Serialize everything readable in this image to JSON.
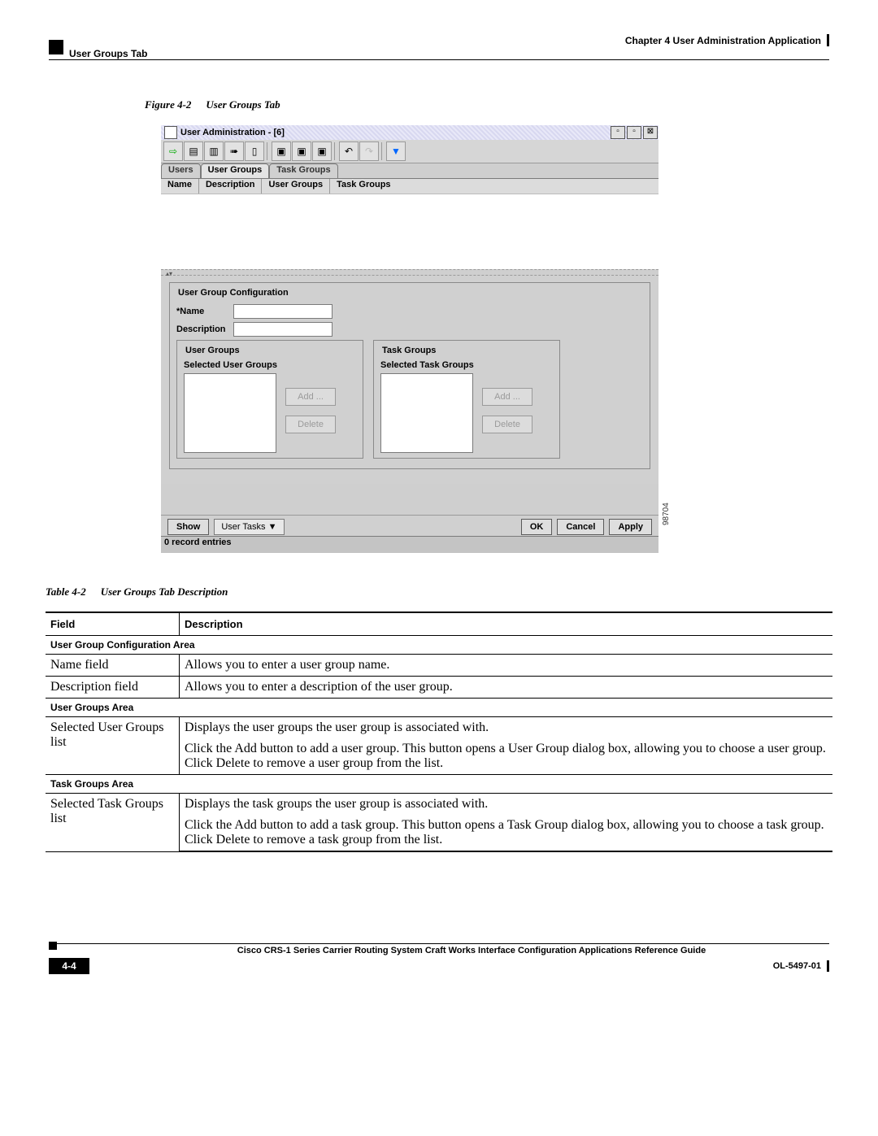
{
  "header": {
    "chapter": "Chapter 4    User Administration Application",
    "section": "User Groups Tab"
  },
  "figure_caption": {
    "num": "Figure 4-2",
    "title": "User Groups Tab"
  },
  "screenshot": {
    "window_title": "User Administration - [6]",
    "image_id": "98704",
    "tabs": [
      "Users",
      "User Groups",
      "Task Groups"
    ],
    "active_tab": "User Groups",
    "columns": [
      "Name",
      "Description",
      "User Groups",
      "Task Groups"
    ],
    "form": {
      "legend": "User Group Configuration",
      "name_label": "*Name",
      "description_label": "Description",
      "user_groups": {
        "legend": "User Groups",
        "sublabel": "Selected User Groups",
        "add": "Add ...",
        "delete": "Delete"
      },
      "task_groups": {
        "legend": "Task Groups",
        "sublabel": "Selected Task Groups",
        "add": "Add ...",
        "delete": "Delete"
      }
    },
    "footer": {
      "show": "Show",
      "selector": "User Tasks ▼",
      "ok": "OK",
      "cancel": "Cancel",
      "apply": "Apply"
    },
    "status": "0 record entries"
  },
  "table_caption": {
    "num": "Table 4-2",
    "title": "User Groups Tab Description"
  },
  "table": {
    "headers": {
      "field": "Field",
      "desc": "Description"
    },
    "section1": "User Group Configuration Area",
    "row1": {
      "f": "Name field",
      "d": "Allows you to enter a user group name."
    },
    "row2": {
      "f": "Description field",
      "d": "Allows you to enter a description of the user group."
    },
    "section2": "User Groups Area",
    "row3": {
      "f": "Selected User Groups list",
      "d1": "Displays the user groups the user group is associated with.",
      "d2": "Click the Add button to add a user group. This button opens a User Group dialog box, allowing you to choose a user group. Click Delete to remove a user group from the list."
    },
    "section3": "Task Groups Area",
    "row4": {
      "f": "Selected Task Groups list",
      "d1": "Displays the task groups the user group is associated with.",
      "d2": "Click the Add button to add a task group. This button opens a Task Group dialog box, allowing you to choose a task group. Click Delete to remove a task group from the list."
    }
  },
  "footer_doc": {
    "title": "Cisco CRS-1 Series Carrier Routing System Craft Works Interface Configuration Applications Reference Guide",
    "page": "4-4",
    "docid": "OL-5497-01"
  }
}
